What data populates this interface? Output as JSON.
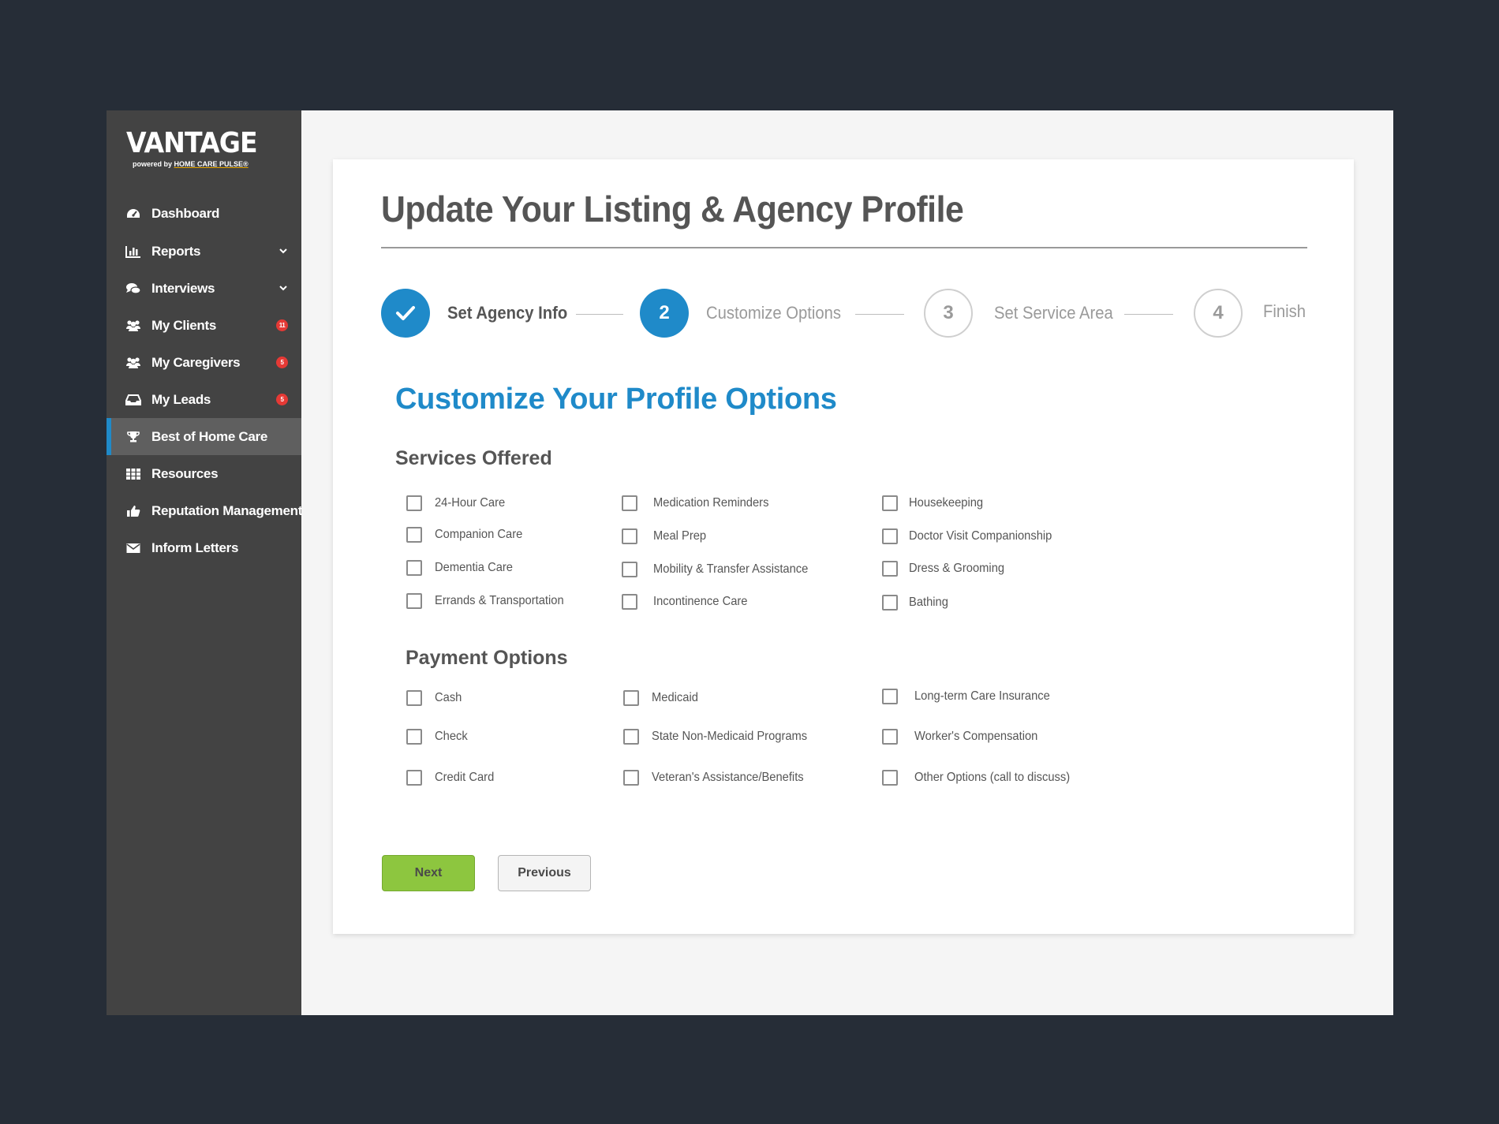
{
  "brand": {
    "name": "VANTAGE",
    "tagline_prefix": "powered by",
    "tagline_brand": "HOME CARE PULSE®"
  },
  "sidebar": {
    "items": [
      {
        "label": "Dashboard",
        "icon": "dashboard-icon"
      },
      {
        "label": "Reports",
        "icon": "bar-chart-icon",
        "caret": "⌄"
      },
      {
        "label": "Interviews",
        "icon": "comments-icon",
        "caret": "⌄"
      },
      {
        "label": "My Clients",
        "icon": "users-icon",
        "badge": "11"
      },
      {
        "label": "My Caregivers",
        "icon": "users-icon",
        "badge": "5"
      },
      {
        "label": "My Leads",
        "icon": "inbox-icon",
        "badge": "5"
      },
      {
        "label": "Best of Home Care",
        "icon": "trophy-icon",
        "active": true
      },
      {
        "label": "Resources",
        "icon": "grid-icon"
      },
      {
        "label": "Reputation Management",
        "icon": "thumbs-up-icon"
      },
      {
        "label": "Inform Letters",
        "icon": "envelope-icon"
      }
    ]
  },
  "page": {
    "title": "Update Your Listing & Agency Profile"
  },
  "stepper": {
    "steps": [
      {
        "number": "✓",
        "label": "Set Agency Info",
        "state": "done"
      },
      {
        "number": "2",
        "label": "Customize Options",
        "state": "current"
      },
      {
        "number": "3",
        "label": "Set Service Area",
        "state": "todo"
      },
      {
        "number": "4",
        "label": "Finish",
        "state": "todo"
      }
    ]
  },
  "form": {
    "title": "Customize Your Profile Options",
    "services": {
      "title": "Services Offered",
      "options": [
        "24-Hour Care",
        "Companion Care",
        "Dementia Care",
        "Errands & Transportation",
        "Medication Reminders",
        "Meal Prep",
        "Mobility & Transfer Assistance",
        "Incontinence Care",
        "Housekeeping",
        "Doctor Visit Companionship",
        "Dress & Grooming",
        "Bathing"
      ]
    },
    "payments": {
      "title": "Payment Options",
      "options": [
        "Cash",
        "Check",
        "Credit Card",
        "Medicaid",
        "State Non-Medicaid Programs",
        "Veteran's Assistance/Benefits",
        "Long-term Care Insurance",
        "Worker's Compensation",
        "Other Options (call to discuss)"
      ]
    },
    "buttons": {
      "next": "Next",
      "previous": "Previous"
    }
  },
  "colors": {
    "accent": "#1f8ac9",
    "next_button": "#8dc63f",
    "sidebar": "#434343",
    "badge": "#e53935"
  }
}
